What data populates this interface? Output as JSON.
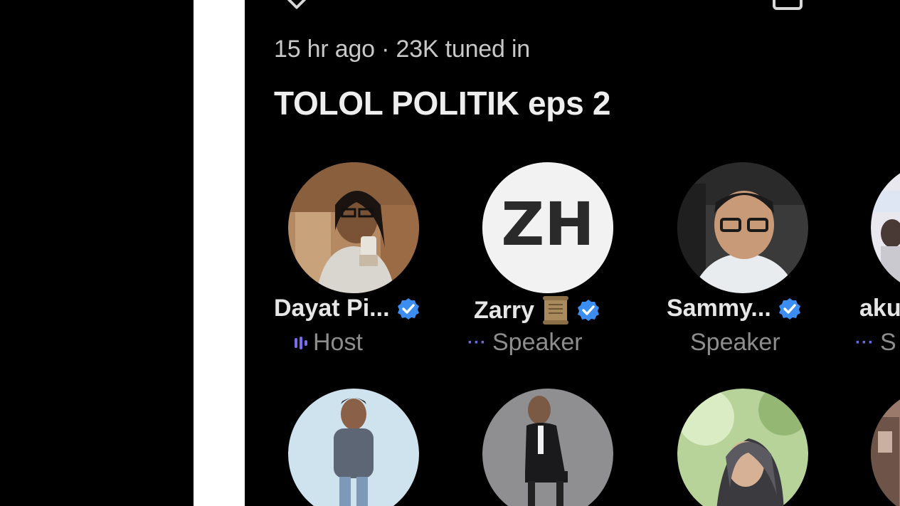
{
  "space": {
    "meta": "15 hr ago · 23K tuned in",
    "title": "TOLOL POLITIK eps 2"
  },
  "participants": [
    {
      "name": "Dayat Pi...",
      "role": "Host",
      "verified": true,
      "role_icon": "speaking-bars-icon"
    },
    {
      "name": "Zarry",
      "role": "Speaker",
      "verified": true,
      "role_icon": "dots-icon",
      "emoji_icon": "scroll-icon",
      "avatar_text": "ZH"
    },
    {
      "name": "Sammy...",
      "role": "Speaker",
      "verified": true,
      "role_icon": "none"
    },
    {
      "name": "aku",
      "role": "S",
      "verified": false,
      "role_icon": "dots-icon"
    }
  ],
  "colors": {
    "background": "#000000",
    "verified_badge": "#3b8df2",
    "role_accent": "#6a6ae8",
    "role_text": "#8d8d8d"
  }
}
